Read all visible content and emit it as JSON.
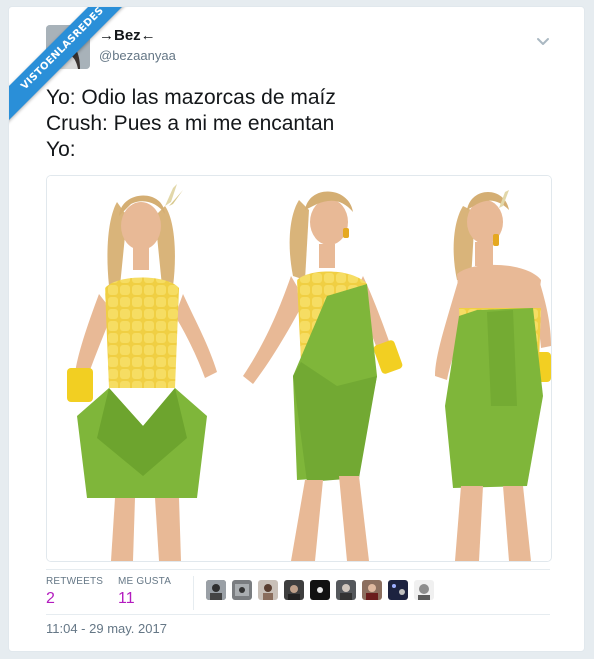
{
  "watermark": "VISTOENLASREDES",
  "tweet": {
    "display_name": "→Bez←",
    "handle": "@bezaanyaa",
    "lines": [
      "Yo: Odio las mazorcas de maíz",
      "Crush: Pues a mi me encantan",
      "Yo:"
    ],
    "timestamp": "11:04 - 29 may. 2017"
  },
  "stats": {
    "retweets_label": "RETWEETS",
    "retweets_value": "2",
    "likes_label": "ME GUSTA",
    "likes_value": "11"
  },
  "colors": {
    "accent_count": "#b31bbf",
    "ribbon": "#2a8fd8",
    "dress_green": "#7fb63a",
    "dress_yellow": "#f2d44e"
  },
  "icons": {
    "menu": "chevron-down-icon"
  }
}
